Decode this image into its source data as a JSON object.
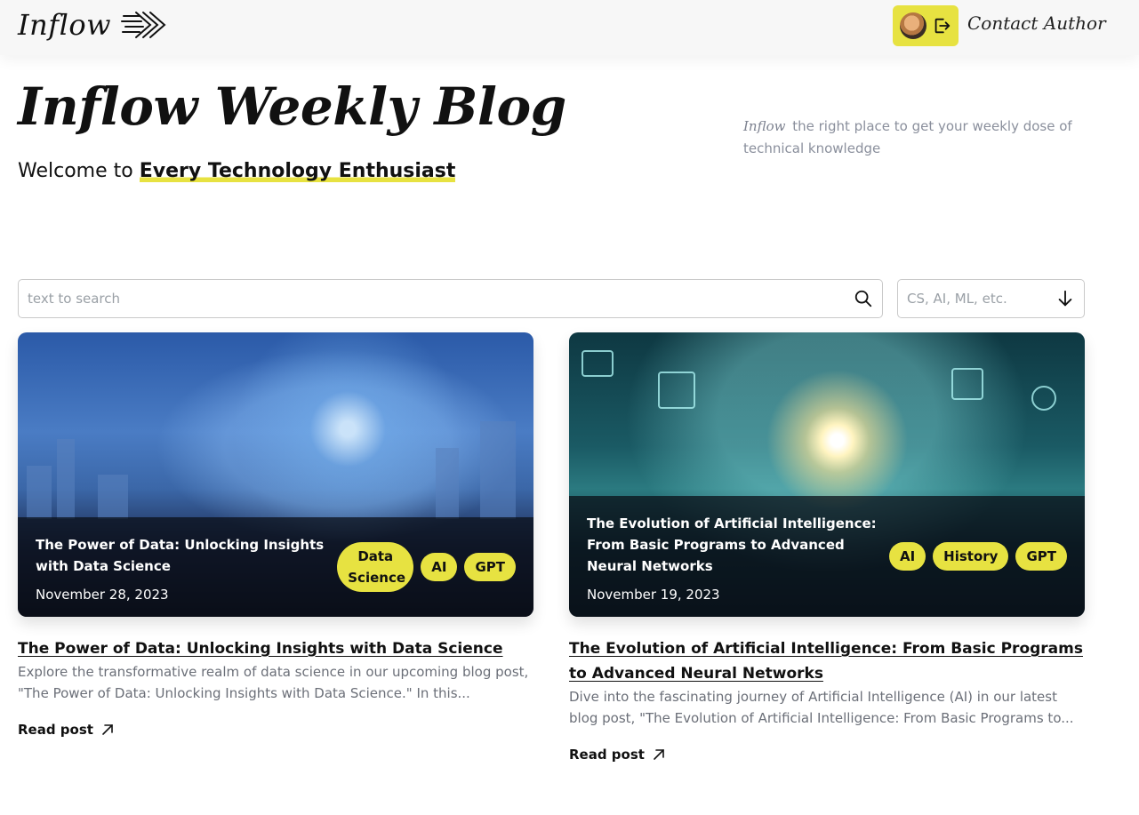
{
  "header": {
    "logo_text": "Inflow",
    "contact_label": "Contact Author"
  },
  "hero": {
    "title": "Inflow Weekly Blog",
    "welcome_prefix": "Welcome to ",
    "welcome_highlight": "Every Technology Enthusiast",
    "tagline_brand": "Inflow",
    "tagline_text": "the right place to get your weekly dose of technical knowledge"
  },
  "search": {
    "placeholder": "text to search",
    "filter_placeholder": "CS, AI, ML, etc."
  },
  "posts": [
    {
      "overlay_title": "The Power of Data: Unlocking Insights with Data Science",
      "date": "November 28, 2023",
      "tags": [
        "Data Science",
        "AI",
        "GPT"
      ],
      "title": "The Power of Data: Unlocking Insights with Data Science",
      "excerpt": "Explore the transformative realm of data science in our upcoming blog post, \"The Power of Data: Unlocking Insights with Data Science.\" In this...",
      "read_label": "Read post"
    },
    {
      "overlay_title": "The Evolution of Artificial Intelligence: From Basic Programs to Advanced Neural Networks",
      "date": "November 19, 2023",
      "tags": [
        "AI",
        "History",
        "GPT"
      ],
      "title": "The Evolution of Artificial Intelligence: From Basic Programs to Advanced Neural Networks",
      "excerpt": "Dive into the fascinating journey of Artificial Intelligence (AI) in our latest blog post, \"The Evolution of Artificial Intelligence: From Basic Programs to...",
      "read_label": "Read post"
    }
  ],
  "colors": {
    "accent": "#e7e241",
    "overlay": "#0a0e16",
    "muted_text": "#6b6f78"
  },
  "icons": [
    "arrows-logo-icon",
    "avatar",
    "logout-icon",
    "search-icon",
    "chevron-down-icon",
    "arrow-up-right-icon"
  ]
}
